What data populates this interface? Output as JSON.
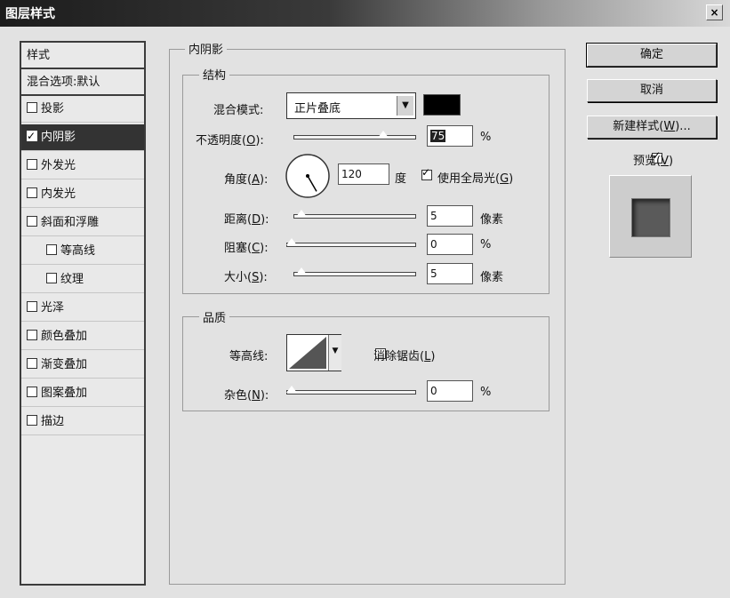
{
  "window": {
    "title": "图层样式",
    "close_glyph": "×"
  },
  "style_list": {
    "header": "样式",
    "blend_default": "混合选项:默认",
    "items": [
      {
        "label": "投影",
        "checked": false,
        "sub": false,
        "selected": false
      },
      {
        "label": "内阴影",
        "checked": true,
        "sub": false,
        "selected": true
      },
      {
        "label": "外发光",
        "checked": false,
        "sub": false,
        "selected": false
      },
      {
        "label": "内发光",
        "checked": false,
        "sub": false,
        "selected": false
      },
      {
        "label": "斜面和浮雕",
        "checked": false,
        "sub": false,
        "selected": false
      },
      {
        "label": "等高线",
        "checked": false,
        "sub": true,
        "selected": false
      },
      {
        "label": "纹理",
        "checked": false,
        "sub": true,
        "selected": false
      },
      {
        "label": "光泽",
        "checked": false,
        "sub": false,
        "selected": false
      },
      {
        "label": "颜色叠加",
        "checked": false,
        "sub": false,
        "selected": false
      },
      {
        "label": "渐变叠加",
        "checked": false,
        "sub": false,
        "selected": false
      },
      {
        "label": "图案叠加",
        "checked": false,
        "sub": false,
        "selected": false
      },
      {
        "label": "描边",
        "checked": false,
        "sub": false,
        "selected": false
      }
    ]
  },
  "inner_shadow": {
    "title": "内阴影",
    "structure": {
      "title": "结构",
      "blend_mode": {
        "label": "混合模式:",
        "value": "正片叠底",
        "color": "#000000"
      },
      "opacity": {
        "label_pre": "不透明度(",
        "key": "O",
        "label_post": "):",
        "value": "75",
        "unit": "%",
        "level": 0.75
      },
      "angle": {
        "label_pre": "角度(",
        "key": "A",
        "label_post": "):",
        "value": "120",
        "unit": "度",
        "degrees": 120
      },
      "global_light": {
        "label_pre": "使用全局光(",
        "key": "G",
        "label_post": ")",
        "checked": true
      },
      "distance": {
        "label_pre": "距离(",
        "key": "D",
        "label_post": "):",
        "value": "5",
        "unit": "像素",
        "level": 0.02
      },
      "choke": {
        "label_pre": "阻塞(",
        "key": "C",
        "label_post": "):",
        "value": "0",
        "unit": "%",
        "level": 0.0
      },
      "size": {
        "label_pre": "大小(",
        "key": "S",
        "label_post": "):",
        "value": "5",
        "unit": "像素",
        "level": 0.02
      }
    },
    "quality": {
      "title": "品质",
      "contour": {
        "label": "等高线:"
      },
      "anti_alias": {
        "label_pre": "消除锯齿(",
        "key": "L",
        "label_post": ")",
        "checked": false
      },
      "noise": {
        "label_pre": "杂色(",
        "key": "N",
        "label_post": "):",
        "value": "0",
        "unit": "%",
        "level": 0.0
      }
    }
  },
  "buttons": {
    "ok": "确定",
    "cancel": "取消",
    "new_style_pre": "新建样式(",
    "new_style_key": "W",
    "new_style_post": ")...",
    "preview_pre": "预览(",
    "preview_key": "V",
    "preview_post": ")",
    "preview_checked": true
  },
  "colors": {
    "selected_bg": "#333333",
    "preview_swatch": "#5a5a5a"
  }
}
